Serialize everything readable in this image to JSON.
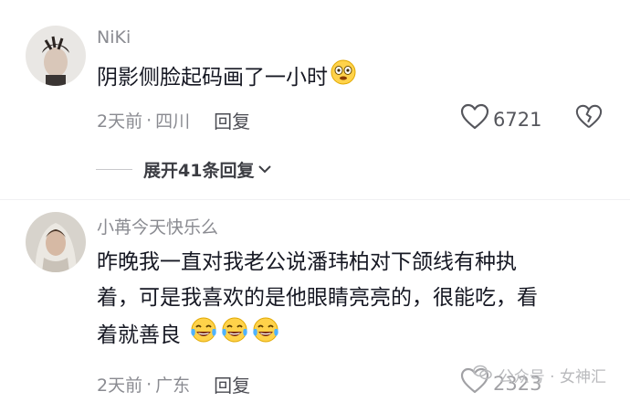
{
  "comments": [
    {
      "username": "NiKi",
      "text": "阴影侧脸起码画了一小时",
      "time": "2天前",
      "location": "四川",
      "reply_label": "回复",
      "likes": "6721",
      "emojis": [
        "astonished-emoji"
      ]
    },
    {
      "username": "小苒今天快乐么",
      "text_lines": [
        "昨晚我一直对我老公说潘玮柏对下颌线有种执",
        "着，可是我喜欢的是他眼睛亮亮的，很能吃，看",
        "着就善良"
      ],
      "time": "2天前",
      "location": "广东",
      "reply_label": "回复",
      "likes": "2323",
      "emojis": [
        "tears-of-joy-emoji",
        "tears-of-joy-emoji",
        "tears-of-joy-emoji"
      ]
    }
  ],
  "expand_replies": {
    "label": "展开41条回复"
  },
  "separator": "·",
  "watermark": {
    "text": "公众号 · 女神汇"
  }
}
